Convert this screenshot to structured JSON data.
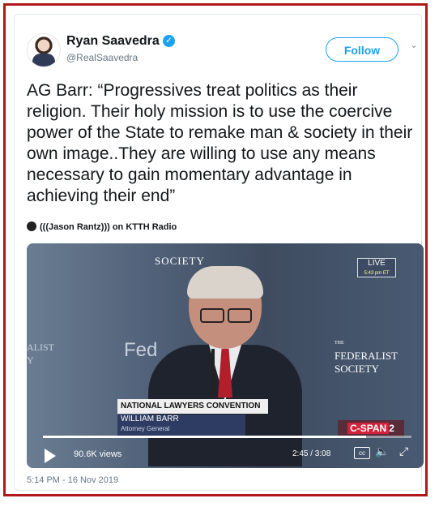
{
  "tweet": {
    "author_name": "Ryan Saavedra",
    "handle": "@RealSaavedra",
    "follow_label": "Follow",
    "text": "AG Barr: “Progressives treat politics as their religion. Their holy mission is to use the coercive power of the State to remake man & society in their own image..They are willing to use any means necessary to gain momentary advantage in achieving their end”",
    "attribution": "(((Jason Rantz))) on KTTH Radio",
    "timestamp": "5:14 PM - 16 Nov 2019"
  },
  "video": {
    "views": "90.6K views",
    "time": "2:45 / 3:08",
    "progress": 0.877,
    "cc_label": "cc",
    "overlay": {
      "society": "SOCIETY",
      "live": "LIVE",
      "live_time": "5:43 pm ET",
      "federalist_the": "THE",
      "federalist": "FEDERALIST",
      "federalist2": "SOCIETY",
      "fed": "Fed",
      "alist": "ALIST",
      "alist2": "Y",
      "chyron_title": "NATIONAL LAWYERS CONVENTION",
      "chyron_name": "WILLIAM BARR",
      "chyron_role": "Attorney General",
      "cspan": "C-SPAN",
      "cspan_num": "2"
    }
  },
  "icons": [
    "verified-icon",
    "chevron-down-icon",
    "play-icon",
    "cc-icon",
    "volume-icon",
    "fullscreen-icon"
  ],
  "colors": {
    "frame": "#b0181c",
    "accent": "#1da1f2"
  }
}
